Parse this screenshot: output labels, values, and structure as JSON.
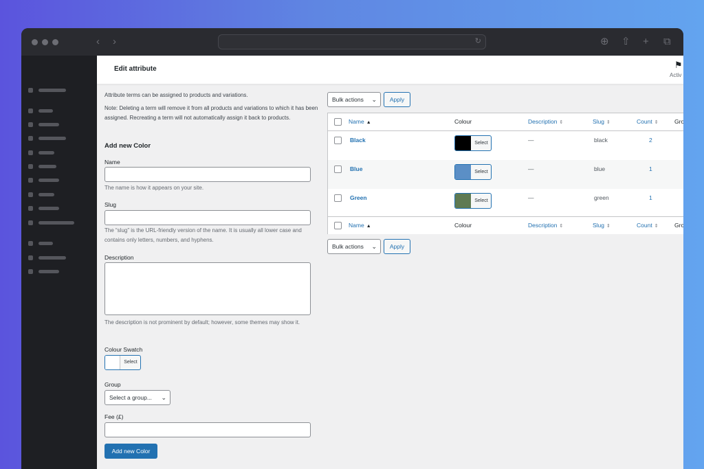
{
  "browser": {
    "url": "",
    "icons": [
      "download-icon",
      "share-icon",
      "new-tab-icon",
      "tabs-icon"
    ]
  },
  "header": {
    "title": "Edit attribute",
    "activity_label": "Activ"
  },
  "form": {
    "intro": "Attribute terms can be assigned to products and variations.",
    "note": "Note: Deleting a term will remove it from all products and variations to which it has been assigned. Recreating a term will not automatically assign it back to products.",
    "heading": "Add new Color",
    "name_label": "Name",
    "name_help": "The name is how it appears on your site.",
    "slug_label": "Slug",
    "slug_help": "The “slug” is the URL-friendly version of the name. It is usually all lower case and contains only letters, numbers, and hyphens.",
    "description_label": "Description",
    "description_help": "The description is not prominent by default; however, some themes may show it.",
    "swatch_label": "Colour Swatch",
    "swatch_select": "Select",
    "group_label": "Group",
    "group_placeholder": "Select a group...",
    "fee_label": "Fee (£)",
    "submit_label": "Add new Color"
  },
  "table": {
    "bulk_label": "Bulk actions",
    "apply_label": "Apply",
    "columns": {
      "name": "Name",
      "colour": "Colour",
      "description": "Description",
      "slug": "Slug",
      "count": "Count",
      "group": "Gro"
    },
    "rows": [
      {
        "name": "Black",
        "swatch": "#000000",
        "select": "Select",
        "description": "—",
        "slug": "black",
        "count": "2"
      },
      {
        "name": "Blue",
        "swatch": "#5b8fc6",
        "select": "Select",
        "description": "—",
        "slug": "blue",
        "count": "1"
      },
      {
        "name": "Green",
        "swatch": "#5f7a52",
        "select": "Select",
        "description": "—",
        "slug": "green",
        "count": "1"
      }
    ]
  },
  "colors": {
    "accent": "#2271b1",
    "background": "#f0f0f1"
  }
}
